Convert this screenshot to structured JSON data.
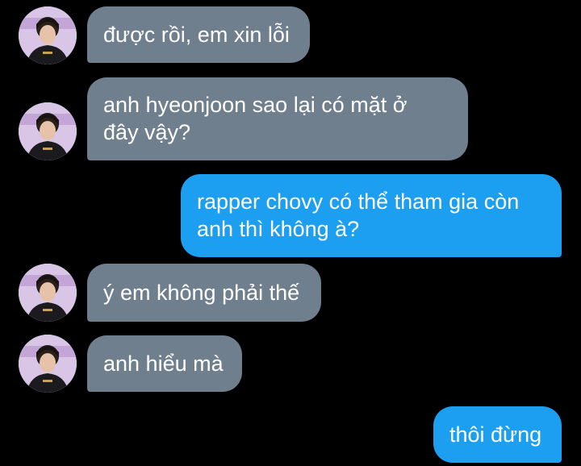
{
  "colors": {
    "background": "#000000",
    "incoming_bubble": "#6f7f8d",
    "outgoing_bubble": "#1c9ef1",
    "text": "#ffffff"
  },
  "avatar": {
    "icon": "user-avatar-icon"
  },
  "messages": [
    {
      "side": "incoming",
      "lines": [
        "được rồi, em xin lỗi"
      ]
    },
    {
      "side": "incoming",
      "lines": [
        "anh hyeonjoon sao lại có mặt ở",
        "đây vậy?"
      ]
    },
    {
      "side": "outgoing",
      "lines": [
        "rapper chovy có thể tham gia còn",
        "anh thì không à?"
      ]
    },
    {
      "side": "incoming",
      "lines": [
        "ý em không phải thế"
      ]
    },
    {
      "side": "incoming",
      "lines": [
        "anh hiểu mà"
      ]
    },
    {
      "side": "outgoing",
      "lines": [
        "thôi đừng"
      ]
    }
  ]
}
